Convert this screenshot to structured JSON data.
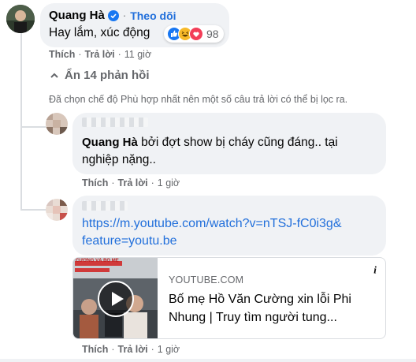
{
  "comment1": {
    "author": "Quang Hà",
    "follow_label": "Theo dõi",
    "text": "Hay lắm, xúc động",
    "reaction_count": "98",
    "like_label": "Thích",
    "reply_label": "Trả lời",
    "time": "11 giờ"
  },
  "hide_replies_label": "Ẩn 14 phản hồi",
  "filter_notice": "Đã chọn chế độ Phù hợp nhất nên một số câu trả lời có thể bị lọc ra.",
  "reply1": {
    "mention": "Quang Hà",
    "text": " bởi đợt show bị cháy cũng đáng.. tại nghiệp nặng..",
    "like_label": "Thích",
    "reply_label": "Trả lời",
    "time": "1 giờ"
  },
  "reply2": {
    "link_line1": "https://m.youtube.com/watch?v=nTSJ-fC0i3g&",
    "link_line2": "feature=youtu.be",
    "preview": {
      "domain": "YOUTUBE.COM",
      "title_line1": "Bố mẹ Hồ Văn Cường xin lỗi Phi",
      "title_line2": "Nhung | Truy tìm người tung...",
      "thumb_caption": "CƯỜNG VÀ BỐ MẸ"
    },
    "like_label": "Thích",
    "reply_label": "Trả lời",
    "time": "1 giờ"
  },
  "colors": {
    "link": "#216fdb",
    "verified": "#1877f2",
    "secondary_text": "#65676b",
    "bubble": "#f0f2f5"
  },
  "icons": [
    "verified-badge-icon",
    "like-reaction-icon",
    "haha-reaction-icon",
    "love-reaction-icon",
    "chevron-up-icon",
    "play-icon",
    "info-icon"
  ]
}
